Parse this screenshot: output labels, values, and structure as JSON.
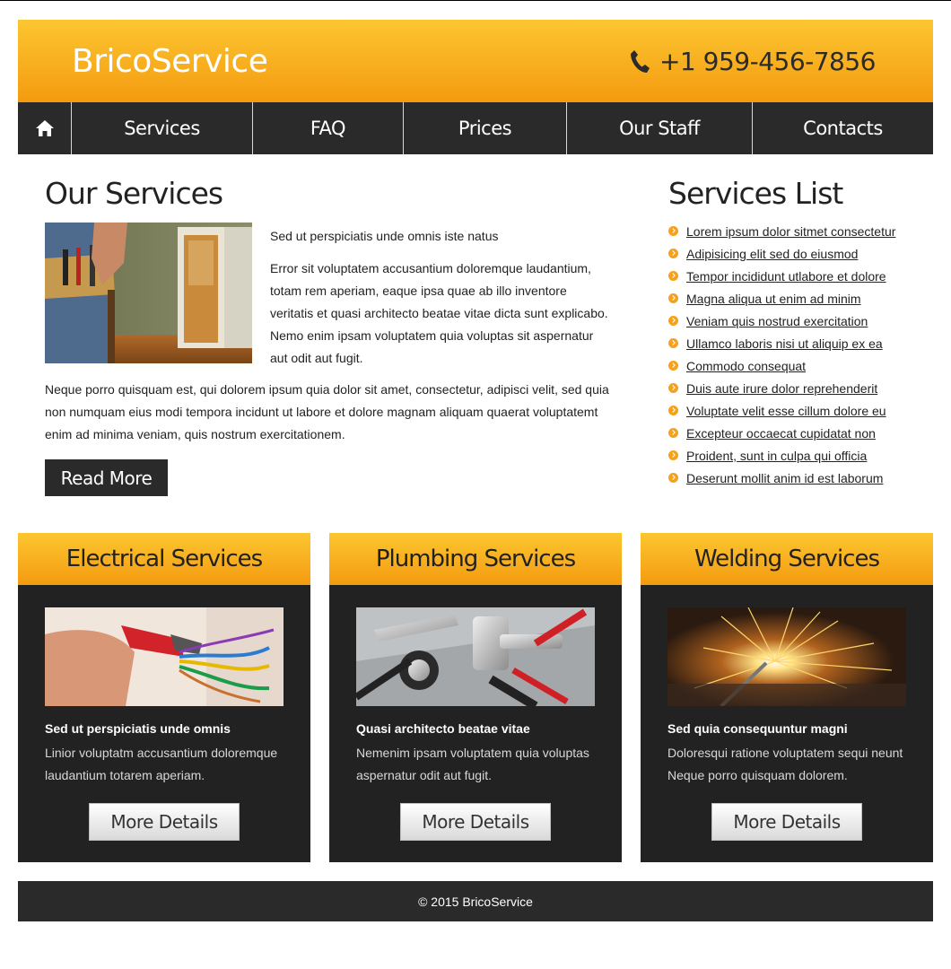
{
  "header": {
    "logo": "BricoService",
    "phone": "+1 959-456-7856",
    "phone_icon": "phone-icon"
  },
  "nav": {
    "home_icon": "home-icon",
    "items": [
      "Services",
      "FAQ",
      "Prices",
      "Our Staff",
      "Contacts"
    ]
  },
  "main": {
    "title": "Our Services",
    "intro_lead": "Sed ut perspiciatis unde omnis iste natus",
    "intro_body": "Error sit voluptatem accusantium doloremque laudantium, totam rem aperiam, eaque ipsa quae ab illo inventore veritatis et quasi architecto beatae vitae dicta sunt explicabo. Nemo enim ipsam voluptatem quia voluptas sit aspernatur aut odit aut fugit.",
    "paragraph": "Neque porro quisquam est, qui dolorem ipsum quia dolor sit amet, consectetur, adipisci velit, sed quia non numquam eius modi tempora incidunt ut labore et dolore magnam aliquam quaerat voluptatemt enim ad minima veniam, quis nostrum exercitationem.",
    "read_more": "Read More"
  },
  "services_list": {
    "title": "Services List",
    "items": [
      "Lorem ipsum dolor sitmet consectetur",
      "Adipisicing elit sed do eiusmod",
      "Tempor incididunt utlabore et dolore",
      "Magna aliqua ut enim ad minim",
      "Veniam quis nostrud exercitation",
      "Ullamco laboris nisi ut aliquip ex ea",
      "Commodo consequat",
      "Duis aute irure dolor reprehenderit",
      "Voluptate velit esse cillum dolore eu",
      "Excepteur occaecat cupidatat non",
      "Proident, sunt in culpa qui officia",
      "Deserunt mollit anim id est laborum"
    ]
  },
  "cards": [
    {
      "title": "Electrical Services",
      "subtitle": "Sed ut perspiciatis unde omnis",
      "text": "Linior voluptatm accusantium doloremque laudantium totarem aperiam.",
      "button": "More Details"
    },
    {
      "title": "Plumbing Services",
      "subtitle": "Quasi architecto beatae vitae",
      "text": "Nemenim ipsam voluptatem quia voluptas aspernatur odit aut fugit.",
      "button": "More Details"
    },
    {
      "title": "Welding Services",
      "subtitle": "Sed quia consequuntur magni",
      "text": "Doloresqui ratione voluptatem sequi neunt Neque porro quisquam dolorem.",
      "button": "More Details"
    }
  ],
  "footer": {
    "copyright": "© 2015 BricoService"
  },
  "colors": {
    "accent_top": "#fcc630",
    "accent_bottom": "#f49b10",
    "dark": "#2a2a2a"
  }
}
